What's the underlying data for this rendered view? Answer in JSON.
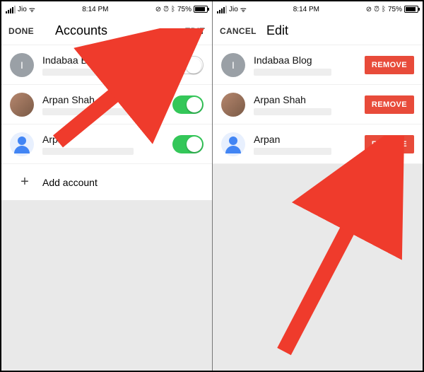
{
  "status": {
    "carrier": "Jio",
    "time": "8:14 PM",
    "battery_pct": "75%"
  },
  "left": {
    "nav": {
      "left": "DONE",
      "title": "Accounts",
      "right": "EDIT"
    },
    "rows": [
      {
        "name": "Indabaa Blog",
        "avatar": "grey",
        "avatarLetter": "I",
        "toggle": "off"
      },
      {
        "name": "Arpan Shah",
        "avatar": "photo",
        "avatarLetter": "",
        "toggle": "on"
      },
      {
        "name": "Arpan",
        "avatar": "blue",
        "avatarLetter": "",
        "toggle": "on"
      }
    ],
    "add_label": "Add account"
  },
  "right": {
    "nav": {
      "left": "CANCEL",
      "title": "Edit",
      "right": ""
    },
    "rows": [
      {
        "name": "Indabaa Blog",
        "avatar": "grey",
        "avatarLetter": "I",
        "action": "REMOVE"
      },
      {
        "name": "Arpan Shah",
        "avatar": "photo",
        "avatarLetter": "",
        "action": "REMOVE"
      },
      {
        "name": "Arpan",
        "avatar": "blue",
        "avatarLetter": "",
        "action": "REMOVE"
      }
    ]
  },
  "arrow_color": "#ef3b2c"
}
